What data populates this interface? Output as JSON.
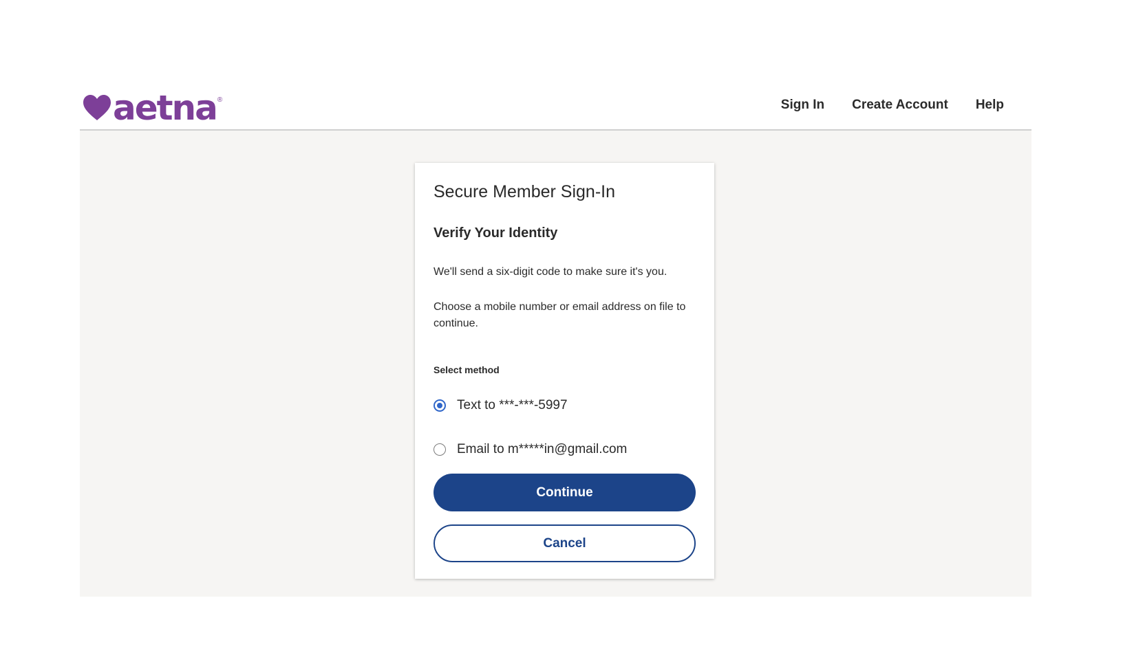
{
  "header": {
    "logo_text": "aetna",
    "logo_mark": "®",
    "brand_color": "#7d3f98",
    "nav": [
      {
        "label": "Sign In"
      },
      {
        "label": "Create Account"
      },
      {
        "label": "Help"
      }
    ]
  },
  "card": {
    "title": "Secure Member Sign-In",
    "subtitle": "Verify Your Identity",
    "paragraph1": "We'll send a six-digit code to make sure it's you.",
    "paragraph2": "Choose a mobile number or email address on file to continue.",
    "method_label": "Select method",
    "options": [
      {
        "label": "Text to ***-***-5997",
        "checked": true
      },
      {
        "label": "Email to m*****in@gmail.com",
        "checked": false
      }
    ],
    "continue_label": "Continue",
    "cancel_label": "Cancel",
    "primary_color": "#1c4489",
    "radio_color": "#2f66c9"
  }
}
